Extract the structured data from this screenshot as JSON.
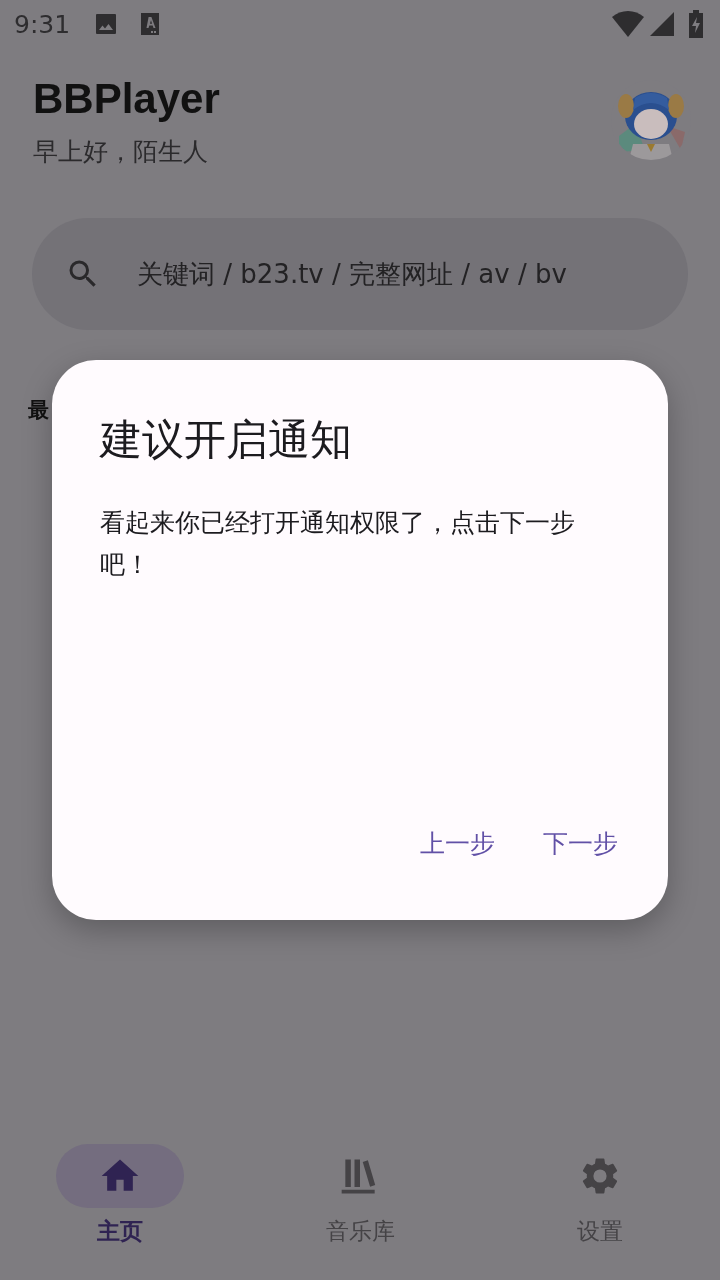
{
  "status_bar": {
    "time": "9:31"
  },
  "header": {
    "title": "BBPlayer",
    "greeting": "早上好，陌生人"
  },
  "search": {
    "placeholder": "关键词 / b23.tv / 完整网址 / av / bv"
  },
  "section_heading": "最",
  "dialog": {
    "title": "建议开启通知",
    "message": "看起来你已经打开通知权限了，点击下一步吧！",
    "buttons": [
      {
        "label": "上一步"
      },
      {
        "label": "下一步"
      }
    ]
  },
  "nav": [
    {
      "label": "主页",
      "selected": true
    },
    {
      "label": "音乐库",
      "selected": false
    },
    {
      "label": "设置",
      "selected": false
    }
  ]
}
